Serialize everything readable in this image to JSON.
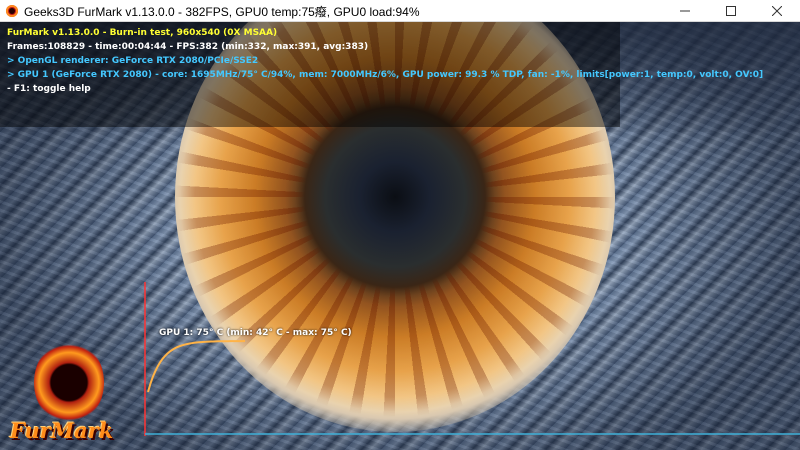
{
  "window": {
    "title": "Geeks3D FurMark v1.13.0.0 - 382FPS, GPU0 temp:75癈, GPU0 load:94%",
    "minimize_icon": "minimize-icon",
    "maximize_icon": "maximize-icon",
    "close_icon": "close-icon"
  },
  "hud": {
    "line1": "FurMark v1.13.0.0 - Burn-in test, 960x540 (0X MSAA)",
    "line2": "Frames:108829 - time:00:04:44 - FPS:382 (min:332, max:391, avg:383)",
    "line3": "> OpenGL renderer: GeForce RTX 2080/PCIe/SSE2",
    "line4": "> GPU 1 (GeForce RTX 2080) - core: 1695MHz/75° C/94%, mem: 7000MHz/6%, GPU power: 99.3 % TDP, fan: -1%, limits[power:1, temp:0, volt:0, OV:0]",
    "line5": "- F1: toggle help",
    "colors": {
      "title": "#ffff33",
      "info": "#ffffff",
      "gpu": "#44c8ff"
    }
  },
  "graph": {
    "label": "GPU 1: 75° C (min: 42° C - max: 75° C)",
    "current_temp_c": 75,
    "min_temp_c": 42,
    "max_temp_c": 75,
    "colors": {
      "axis": "#ff3333",
      "curve": "#ffb347",
      "baseline": "#3fb0d8"
    }
  },
  "logo": {
    "text": "FurMark",
    "icon": "furmark-logo-icon"
  }
}
